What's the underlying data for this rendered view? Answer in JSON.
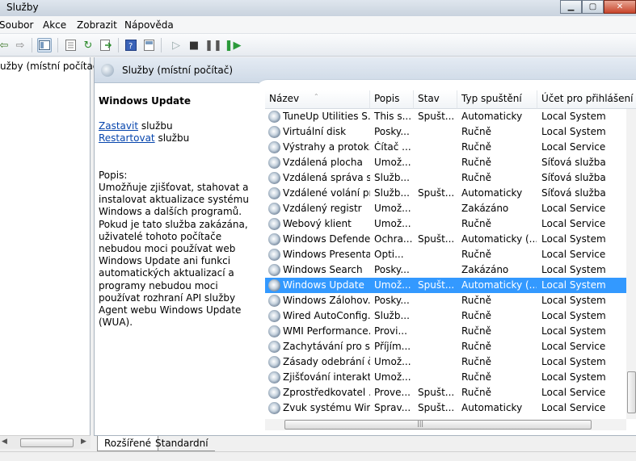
{
  "window": {
    "title": "Služby"
  },
  "menu": [
    "Soubor",
    "Akce",
    "Zobrazit",
    "Nápověda"
  ],
  "tree": {
    "item": "užby (místní počítač)"
  },
  "panel": {
    "title": "Služby (místní počítač)"
  },
  "details": {
    "service_name": "Windows Update",
    "action1_link": "Zastavit",
    "action1_rest": " službu",
    "action2_link": "Restartovat",
    "action2_rest": " službu",
    "description_label": "Popis:",
    "description_text": "Umožňuje zjišťovat, stahovat a instalovat aktualizace systému Windows a dalších programů. Pokud je tato služba zakázána, uživatelé tohoto počítače nebudou moci používat web Windows Update ani funkci automatických aktualizací a programy nebudou moci používat rozhraní API služby Agent webu Windows Update (WUA)."
  },
  "columns": {
    "name": "Název",
    "desc": "Popis",
    "status": "Stav",
    "startup": "Typ spuštění",
    "logon": "Účet pro přihlášení"
  },
  "rows": [
    {
      "name": "TuneUp Utilities S...",
      "desc": "This s...",
      "status": "Spušt...",
      "startup": "Automaticky",
      "logon": "Local System"
    },
    {
      "name": "Virtuální disk",
      "desc": "Posky...",
      "status": "",
      "startup": "Ručně",
      "logon": "Local System"
    },
    {
      "name": "Výstrahy a protok...",
      "desc": "Čítač ...",
      "status": "",
      "startup": "Ručně",
      "logon": "Local Service"
    },
    {
      "name": "Vzdálená plocha",
      "desc": "Umož...",
      "status": "",
      "startup": "Ručně",
      "logon": "Síťová služba"
    },
    {
      "name": "Vzdálená správa s...",
      "desc": "Služb...",
      "status": "",
      "startup": "Ručně",
      "logon": "Síťová služba"
    },
    {
      "name": "Vzdálené volání pr...",
      "desc": "Služb...",
      "status": "Spušt...",
      "startup": "Automaticky",
      "logon": "Síťová služba"
    },
    {
      "name": "Vzdálený registr",
      "desc": "Umož...",
      "status": "",
      "startup": "Zakázáno",
      "logon": "Local Service"
    },
    {
      "name": "Webový klient",
      "desc": "Umož...",
      "status": "",
      "startup": "Ručně",
      "logon": "Local Service"
    },
    {
      "name": "Windows Defender",
      "desc": "Ochra...",
      "status": "Spušt...",
      "startup": "Automaticky (...",
      "logon": "Local System"
    },
    {
      "name": "Windows Presenta...",
      "desc": "Opti...",
      "status": "",
      "startup": "Ručně",
      "logon": "Local Service"
    },
    {
      "name": "Windows Search",
      "desc": "Posky...",
      "status": "",
      "startup": "Zakázáno",
      "logon": "Local System"
    },
    {
      "name": "Windows Update",
      "desc": "Umož...",
      "status": "Spušt...",
      "startup": "Automaticky (...",
      "logon": "Local System"
    },
    {
      "name": "Windows Zálohov...",
      "desc": "Posky...",
      "status": "",
      "startup": "Ručně",
      "logon": "Local System"
    },
    {
      "name": "Wired AutoConfig...",
      "desc": "Služb...",
      "status": "",
      "startup": "Ručně",
      "logon": "Local System"
    },
    {
      "name": "WMI Performance...",
      "desc": "Provi...",
      "status": "",
      "startup": "Ručně",
      "logon": "Local System"
    },
    {
      "name": "Zachytávání pro sl...",
      "desc": "Příjím...",
      "status": "",
      "startup": "Ručně",
      "logon": "Local Service"
    },
    {
      "name": "Zásady odebrání č...",
      "desc": "Umož...",
      "status": "",
      "startup": "Ručně",
      "logon": "Local System"
    },
    {
      "name": "Zjišťování interakt...",
      "desc": "Umož...",
      "status": "",
      "startup": "Ručně",
      "logon": "Local System"
    },
    {
      "name": "Zprostředkovatel ...",
      "desc": "Prove...",
      "status": "Spušt...",
      "startup": "Ručně",
      "logon": "Local Service"
    },
    {
      "name": "Zvuk systému Win...",
      "desc": "Sprav...",
      "status": "Spušt...",
      "startup": "Automaticky",
      "logon": "Local Service"
    }
  ],
  "selected_row": 11,
  "tabs": {
    "extended": "Rozšířené",
    "standard": "Standardní"
  },
  "colors": {
    "selection": "#3399ff",
    "link": "#0645ad"
  }
}
